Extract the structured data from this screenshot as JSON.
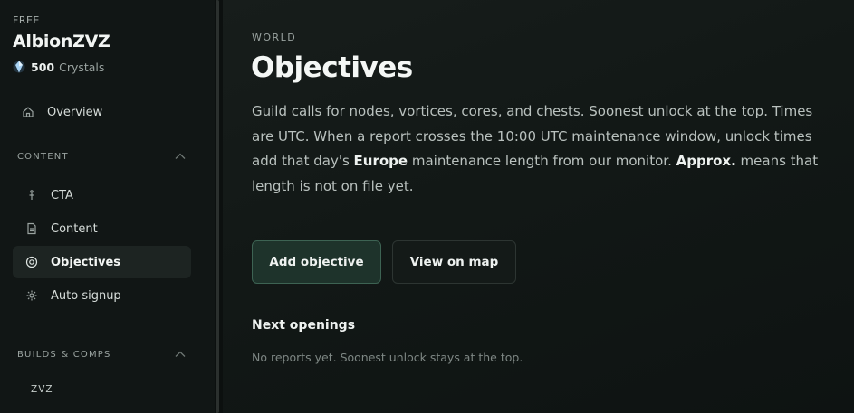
{
  "sidebar": {
    "plan": "FREE",
    "app_name": "AlbionZVZ",
    "crystals": {
      "amount": "500",
      "label": "Crystals"
    },
    "overview": {
      "label": "Overview",
      "icon": "home-icon"
    },
    "sections": [
      {
        "title": "CONTENT",
        "items": [
          {
            "label": "CTA",
            "icon": "figure-icon"
          },
          {
            "label": "Content",
            "icon": "document-icon"
          },
          {
            "label": "Objectives",
            "icon": "target-icon",
            "active": true
          },
          {
            "label": "Auto signup",
            "icon": "sparkle-icon"
          }
        ]
      },
      {
        "title": "BUILDS & COMPS",
        "items": [
          {
            "label": "ZVZ"
          }
        ]
      }
    ]
  },
  "main": {
    "eyebrow": "WORLD",
    "title": "Objectives",
    "description": {
      "part1": "Guild calls for nodes, vortices, cores, and chests. Soonest unlock at the top. Times are UTC. When a report crosses the 10:00 UTC maintenance window, unlock times add that day's ",
      "bold1": "Europe",
      "part2": " maintenance length from our monitor. ",
      "bold2": "Approx.",
      "part3": " means that length is not on file yet."
    },
    "buttons": {
      "add_objective": "Add objective",
      "view_on_map": "View on map"
    },
    "next_openings": {
      "title": "Next openings",
      "empty_text": "No reports yet. Soonest unlock stays at the top."
    }
  },
  "colors": {
    "background": "#0f1413",
    "sidebar": "#111615",
    "active_item": "#1d2422",
    "primary_button": "#1e332b",
    "primary_border": "#3d6353"
  }
}
